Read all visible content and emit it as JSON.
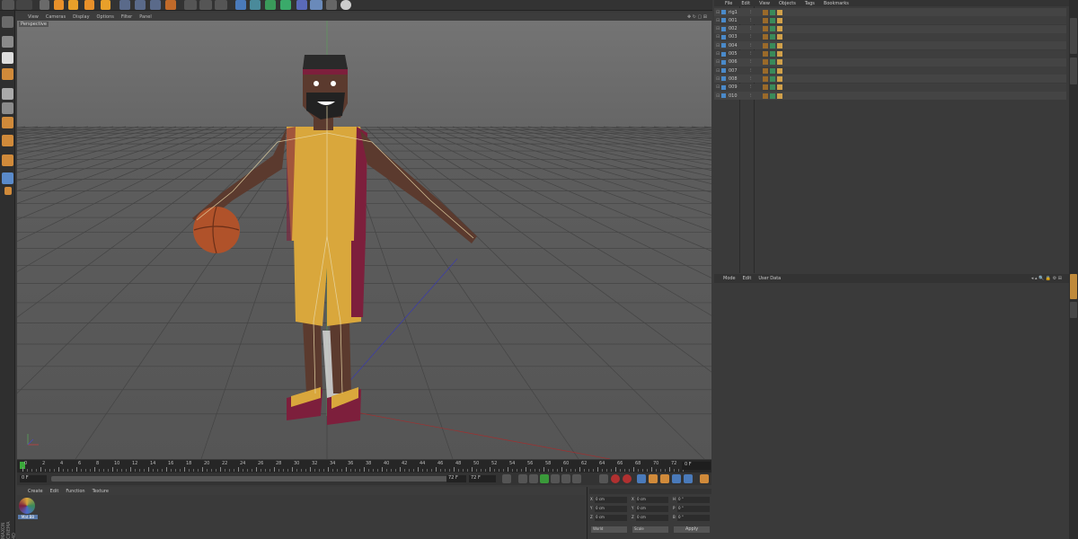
{
  "viewport_menu": [
    "View",
    "Cameras",
    "Display",
    "Options",
    "Filter",
    "Panel"
  ],
  "viewport_label": "Perspective",
  "timeline": {
    "ticks": [
      "0",
      "2",
      "4",
      "6",
      "8",
      "10",
      "12",
      "14",
      "16",
      "18",
      "20",
      "22",
      "24",
      "26",
      "28",
      "30",
      "32",
      "34",
      "36",
      "38",
      "40",
      "42",
      "44",
      "46",
      "48",
      "50",
      "52",
      "54",
      "56",
      "58",
      "60",
      "62",
      "64",
      "66",
      "68",
      "70",
      "72"
    ],
    "current_frame": "0 F",
    "start_field": "0 F",
    "end_field": "72 F",
    "range_end": "72 F"
  },
  "material_menu": [
    "Create",
    "Edit",
    "Function",
    "Texture"
  ],
  "material_name": "Mat.BB",
  "object_menu": [
    "File",
    "Edit",
    "View",
    "Objects",
    "Tags",
    "Bookmarks"
  ],
  "objects": [
    "rig1",
    "001",
    "002",
    "003",
    "004",
    "005",
    "006",
    "007",
    "008",
    "009",
    "010"
  ],
  "attr_menu": [
    "Mode",
    "Edit",
    "User Data"
  ],
  "coords": {
    "rows": [
      {
        "axis": "X",
        "pos": "0 cm",
        "size_axis": "X",
        "size": "0 cm",
        "rot_axis": "H",
        "rot": "0 °"
      },
      {
        "axis": "Y",
        "pos": "0 cm",
        "size_axis": "Y",
        "size": "0 cm",
        "rot_axis": "P",
        "rot": "0 °"
      },
      {
        "axis": "Z",
        "pos": "0 cm",
        "size_axis": "Z",
        "size": "0 cm",
        "rot_axis": "B",
        "rot": "0 °"
      }
    ],
    "mode": "World",
    "size_mode": "Scale",
    "apply": "Apply"
  },
  "side_logo": "MAXON CINEMA 4D",
  "colors": {
    "jersey": "#d9a73c",
    "trim": "#7d1f3c",
    "skin": "#5b3a2e",
    "ball": "#b0522a",
    "grid": "#6e6e6e"
  }
}
